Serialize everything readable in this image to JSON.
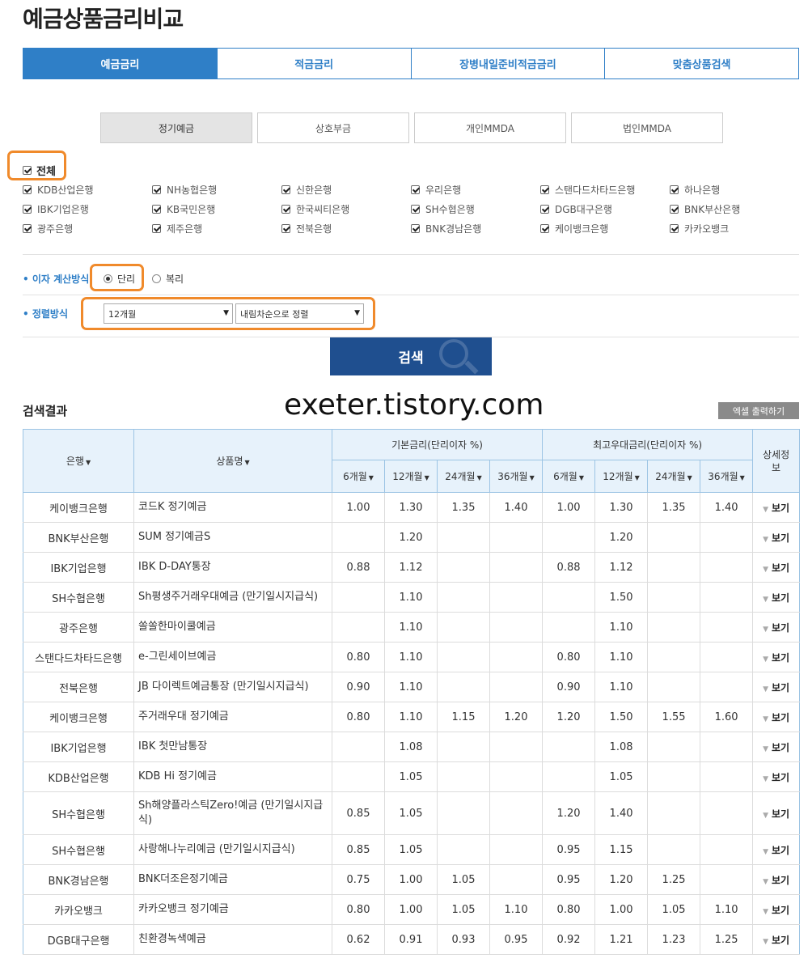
{
  "page_title": "예금상품금리비교",
  "tabs": [
    "예금금리",
    "적금금리",
    "장병내일준비적금금리",
    "맞춤상품검색"
  ],
  "subtabs": [
    "정기예금",
    "상호부금",
    "개인MMDA",
    "법인MMDA"
  ],
  "all_label": "전체",
  "banks": [
    "KDB산업은행",
    "NH농협은행",
    "신한은행",
    "우리은행",
    "스탠다드차타드은행",
    "하나은행",
    "IBK기업은행",
    "KB국민은행",
    "한국씨티은행",
    "SH수협은행",
    "DGB대구은행",
    "BNK부산은행",
    "광주은행",
    "제주은행",
    "전북은행",
    "BNK경남은행",
    "케이뱅크은행",
    "카카오뱅크"
  ],
  "interest": {
    "label": "• 이자 계산방식",
    "simple": "단리",
    "compound": "복리",
    "selected": "단리"
  },
  "sort": {
    "label": "• 정렬방식",
    "period": "12개월",
    "order": "내림차순으로 정렬"
  },
  "search_button": "검색",
  "result_title": "검색결과",
  "watermark": "exeter.tistory.com",
  "excel_button": "엑셀 출력하기",
  "table": {
    "col_bank": "은행",
    "col_product": "상품명",
    "group_base": "기본금리(단리이자 %)",
    "group_max": "최고우대금리(단리이자 %)",
    "col_detail": "상세정보",
    "periods": [
      "6개월",
      "12개월",
      "24개월",
      "36개월"
    ],
    "view_label": "보기",
    "rows": [
      {
        "bank": "케이뱅크은행",
        "product": "코드K 정기예금",
        "base": [
          "1.00",
          "1.30",
          "1.35",
          "1.40"
        ],
        "max": [
          "1.00",
          "1.30",
          "1.35",
          "1.40"
        ]
      },
      {
        "bank": "BNK부산은행",
        "product": "SUM 정기예금S",
        "base": [
          "",
          "1.20",
          "",
          ""
        ],
        "max": [
          "",
          "1.20",
          "",
          ""
        ]
      },
      {
        "bank": "IBK기업은행",
        "product": "IBK D-DAY통장",
        "base": [
          "0.88",
          "1.12",
          "",
          ""
        ],
        "max": [
          "0.88",
          "1.12",
          "",
          ""
        ]
      },
      {
        "bank": "SH수협은행",
        "product": "Sh평생주거래우대예금 (만기일시지급식)",
        "base": [
          "",
          "1.10",
          "",
          ""
        ],
        "max": [
          "",
          "1.50",
          "",
          ""
        ]
      },
      {
        "bank": "광주은행",
        "product": "쏠쏠한마이쿨예금",
        "base": [
          "",
          "1.10",
          "",
          ""
        ],
        "max": [
          "",
          "1.10",
          "",
          ""
        ]
      },
      {
        "bank": "스탠다드차타드은행",
        "product": "e-그린세이브예금",
        "base": [
          "0.80",
          "1.10",
          "",
          ""
        ],
        "max": [
          "0.80",
          "1.10",
          "",
          ""
        ]
      },
      {
        "bank": "전북은행",
        "product": "JB 다이렉트예금통장 (만기일시지급식)",
        "base": [
          "0.90",
          "1.10",
          "",
          ""
        ],
        "max": [
          "0.90",
          "1.10",
          "",
          ""
        ]
      },
      {
        "bank": "케이뱅크은행",
        "product": "주거래우대 정기예금",
        "base": [
          "0.80",
          "1.10",
          "1.15",
          "1.20"
        ],
        "max": [
          "1.20",
          "1.50",
          "1.55",
          "1.60"
        ]
      },
      {
        "bank": "IBK기업은행",
        "product": "IBK 첫만남통장",
        "base": [
          "",
          "1.08",
          "",
          ""
        ],
        "max": [
          "",
          "1.08",
          "",
          ""
        ]
      },
      {
        "bank": "KDB산업은행",
        "product": "KDB Hi 정기예금",
        "base": [
          "",
          "1.05",
          "",
          ""
        ],
        "max": [
          "",
          "1.05",
          "",
          ""
        ]
      },
      {
        "bank": "SH수협은행",
        "product": "Sh해양플라스틱Zero!예금 (만기일시지급식)",
        "base": [
          "0.85",
          "1.05",
          "",
          ""
        ],
        "max": [
          "1.20",
          "1.40",
          "",
          ""
        ]
      },
      {
        "bank": "SH수협은행",
        "product": "사랑해나누리예금 (만기일시지급식)",
        "base": [
          "0.85",
          "1.05",
          "",
          ""
        ],
        "max": [
          "0.95",
          "1.15",
          "",
          ""
        ]
      },
      {
        "bank": "BNK경남은행",
        "product": "BNK더조은정기예금",
        "base": [
          "0.75",
          "1.00",
          "1.05",
          ""
        ],
        "max": [
          "0.95",
          "1.20",
          "1.25",
          ""
        ]
      },
      {
        "bank": "카카오뱅크",
        "product": "카카오뱅크 정기예금",
        "base": [
          "0.80",
          "1.00",
          "1.05",
          "1.10"
        ],
        "max": [
          "0.80",
          "1.00",
          "1.05",
          "1.10"
        ]
      },
      {
        "bank": "DGB대구은행",
        "product": "친환경녹색예금",
        "base": [
          "0.62",
          "0.91",
          "0.93",
          "0.95"
        ],
        "max": [
          "0.92",
          "1.21",
          "1.23",
          "1.25"
        ]
      }
    ]
  },
  "colors": {
    "accent": "#2f7fc7",
    "highlight": "#f08a2b",
    "search_btn": "#1f4f8f"
  }
}
